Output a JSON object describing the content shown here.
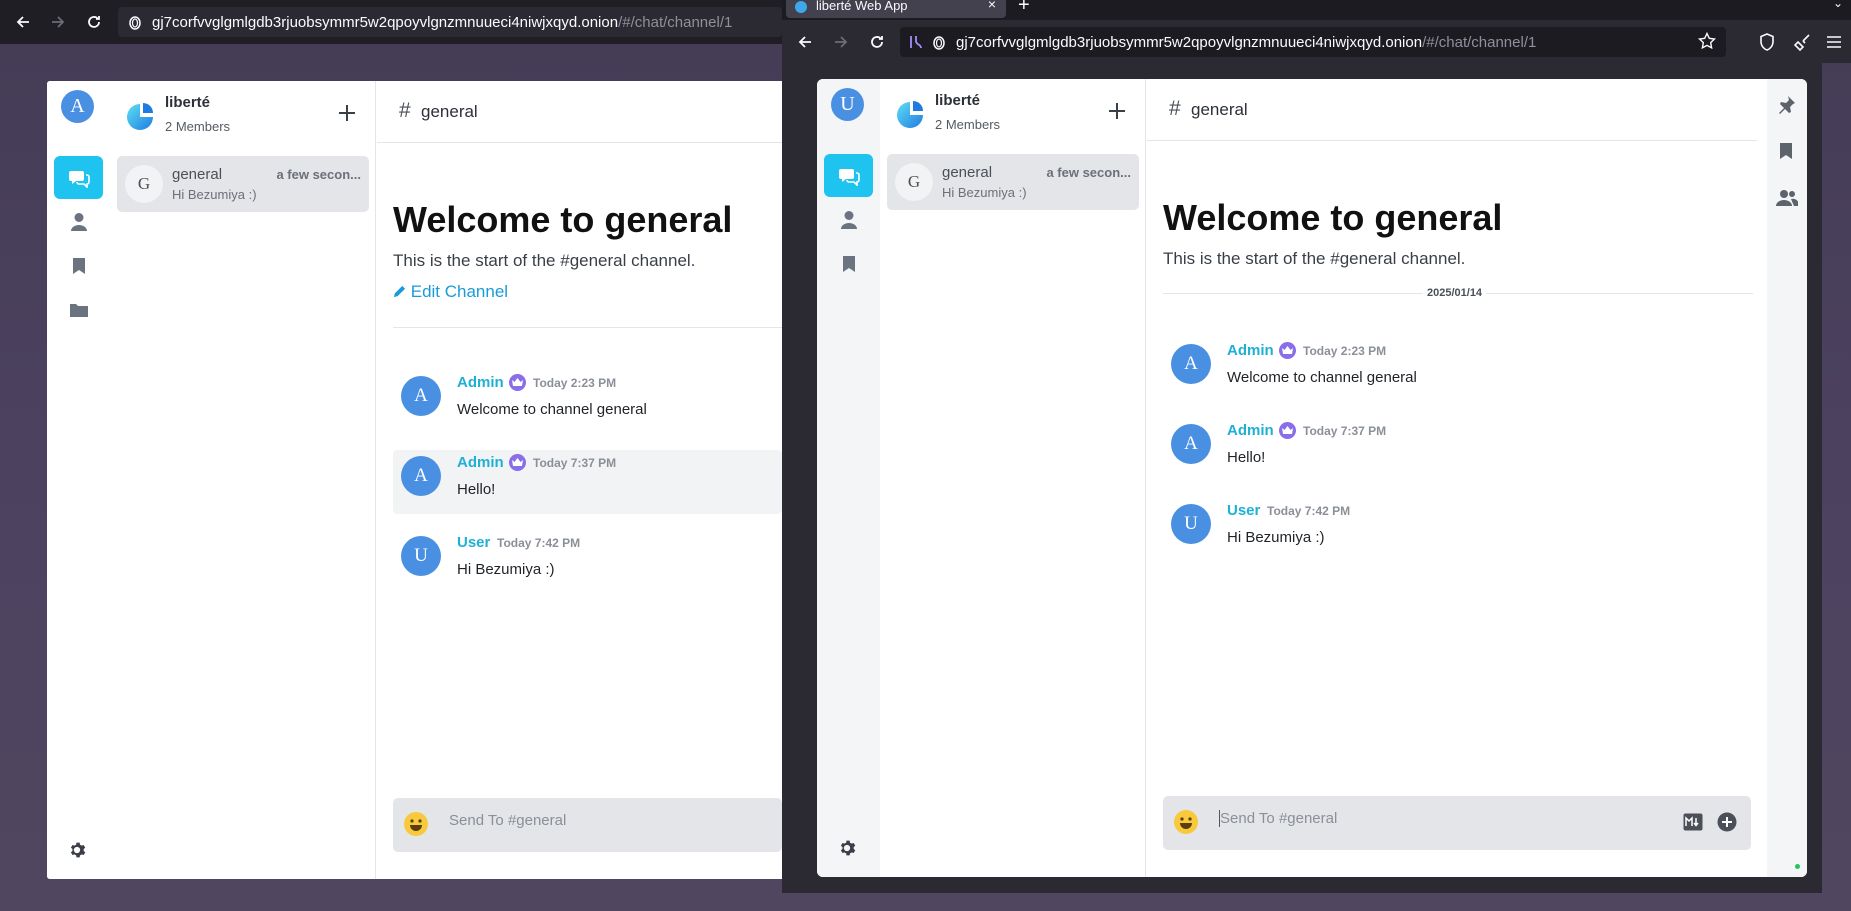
{
  "left_window": {
    "url_host": "gj7corfvvglgmlgdb3rjuobsymmr5w2qpoyvlgnzmnuueci4niwjxqyd.onion",
    "url_path": "/#/chat/channel/1",
    "user_initial": "A",
    "server": {
      "name": "liberté",
      "members": "2 Members"
    },
    "channel_item": {
      "initial": "G",
      "name": "general",
      "time": "a few secon...",
      "preview": "Hi Bezumiya :)"
    },
    "header_title": "general",
    "welcome_title": "Welcome to general",
    "welcome_sub": "This is the start of the #general channel.",
    "edit_channel": "Edit Channel",
    "messages": [
      {
        "initial": "A",
        "author": "Admin",
        "time": "Today 2:23 PM",
        "text": "Welcome to channel general"
      },
      {
        "initial": "A",
        "author": "Admin",
        "time": "Today 7:37 PM",
        "text": "Hello!"
      },
      {
        "initial": "U",
        "author": "User",
        "time": "Today 7:42 PM",
        "text": "Hi Bezumiya :)"
      }
    ],
    "composer_placeholder": "Send To #general"
  },
  "right_window": {
    "tab_title": "liberté Web App",
    "url_host": "gj7corfvvglgmlgdb3rjuobsymmr5w2qpoyvlgnzmnuueci4niwjxqyd.onion",
    "url_path": "/#/chat/channel/1",
    "user_initial": "U",
    "server": {
      "name": "liberté",
      "members": "2 Members"
    },
    "channel_item": {
      "initial": "G",
      "name": "general",
      "time": "a few secon...",
      "preview": "Hi Bezumiya :)"
    },
    "header_title": "general",
    "welcome_title": "Welcome to general",
    "welcome_sub": "This is the start of the #general channel.",
    "date_divider": "2025/01/14",
    "messages": [
      {
        "initial": "A",
        "author": "Admin",
        "time": "Today 2:23 PM",
        "text": "Welcome to channel general"
      },
      {
        "initial": "A",
        "author": "Admin",
        "time": "Today 7:37 PM",
        "text": "Hello!"
      },
      {
        "initial": "U",
        "author": "User",
        "time": "Today 7:42 PM",
        "text": "Hi Bezumiya :)"
      }
    ],
    "composer_placeholder": "Send To #general"
  },
  "colors": {
    "accent": "#1fc3f0",
    "author": "#1fb0d6",
    "avatar": "#4a90e2",
    "crown": "#8a6de9",
    "link": "#1a9bd7"
  }
}
